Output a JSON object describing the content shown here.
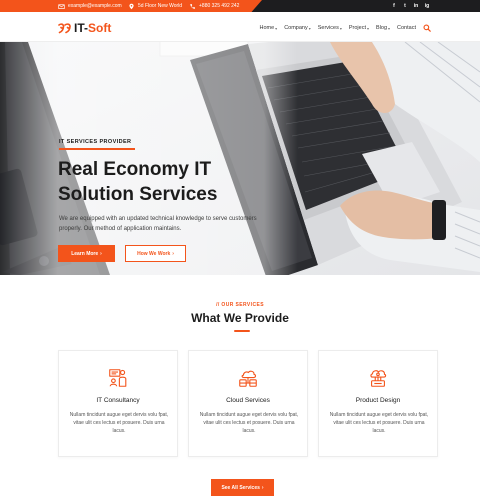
{
  "topbar": {
    "email": "example@example.com",
    "address": "5d Floor New World",
    "phone": "+880 325 492 242",
    "social": [
      "f",
      "t",
      "in",
      "ig"
    ]
  },
  "brand": {
    "name_main": "IT-",
    "name_accent": "Soft"
  },
  "nav": {
    "items": [
      {
        "label": "Home",
        "dropdown": true
      },
      {
        "label": "Company",
        "dropdown": true
      },
      {
        "label": "Services",
        "dropdown": true
      },
      {
        "label": "Project",
        "dropdown": true
      },
      {
        "label": "Blog",
        "dropdown": true
      },
      {
        "label": "Contact",
        "dropdown": false
      }
    ]
  },
  "hero": {
    "tag": "IT SERVICES PROVIDER",
    "title_line1": "Real Economy IT",
    "title_line2": "Solution Services",
    "description": "We are equipped with an updated technical knowledge to serve customers properly. Our method of application maintains.",
    "primary_button": "Learn More",
    "secondary_button": "How We Work"
  },
  "services": {
    "kicker": "// OUR SERVICES",
    "title": "What We Provide",
    "cards": [
      {
        "icon": "consultancy-icon",
        "title": "IT Consultancy",
        "text": "Nullam tincidunt augue eget dervis volu fpat, vitae ulit ces lectus et posuere. Duis urna lacus."
      },
      {
        "icon": "cloud-services-icon",
        "title": "Cloud Services",
        "text": "Nullam tincidunt augue eget dervis volu fpat, vitae ulit ces lectus et posuere. Duis urna lacus."
      },
      {
        "icon": "product-design-icon",
        "title": "Product Design",
        "text": "Nullam tincidunt augue eget dervis volu fpat, vitae ulit ces lectus et posuere. Duis urna lacus."
      }
    ],
    "all_button": "See All Services"
  },
  "colors": {
    "accent": "#f3541b",
    "dark": "#1d1d1f"
  }
}
